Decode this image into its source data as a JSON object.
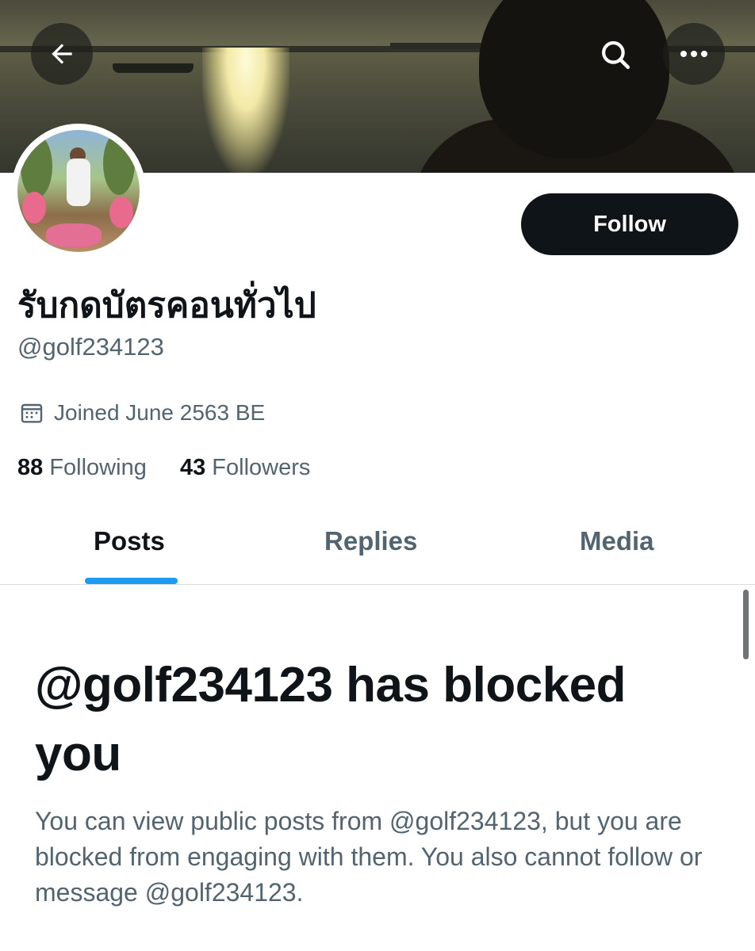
{
  "header": {
    "back_icon": "arrow-left-icon",
    "search_icon": "search-icon",
    "more_icon": "more-horizontal-icon"
  },
  "profile": {
    "display_name": "รับกดบัตรคอนทั่วไป",
    "handle": "@golf234123",
    "joined": "Joined June 2563 BE",
    "following_count": "88",
    "following_label": "Following",
    "followers_count": "43",
    "followers_label": "Followers",
    "follow_label": "Follow"
  },
  "tabs": [
    {
      "label": "Posts",
      "active": true
    },
    {
      "label": "Replies",
      "active": false
    },
    {
      "label": "Media",
      "active": false
    }
  ],
  "blocked": {
    "title": "@golf234123 has blocked you",
    "description": "You can view public posts from @golf234123, but you are blocked from engaging with them. You also cannot follow or message @golf234123."
  },
  "colors": {
    "primary_text": "#0f1419",
    "secondary_text": "#536471",
    "accent": "#1d9bf0",
    "follow_button_bg": "#0f1419"
  }
}
